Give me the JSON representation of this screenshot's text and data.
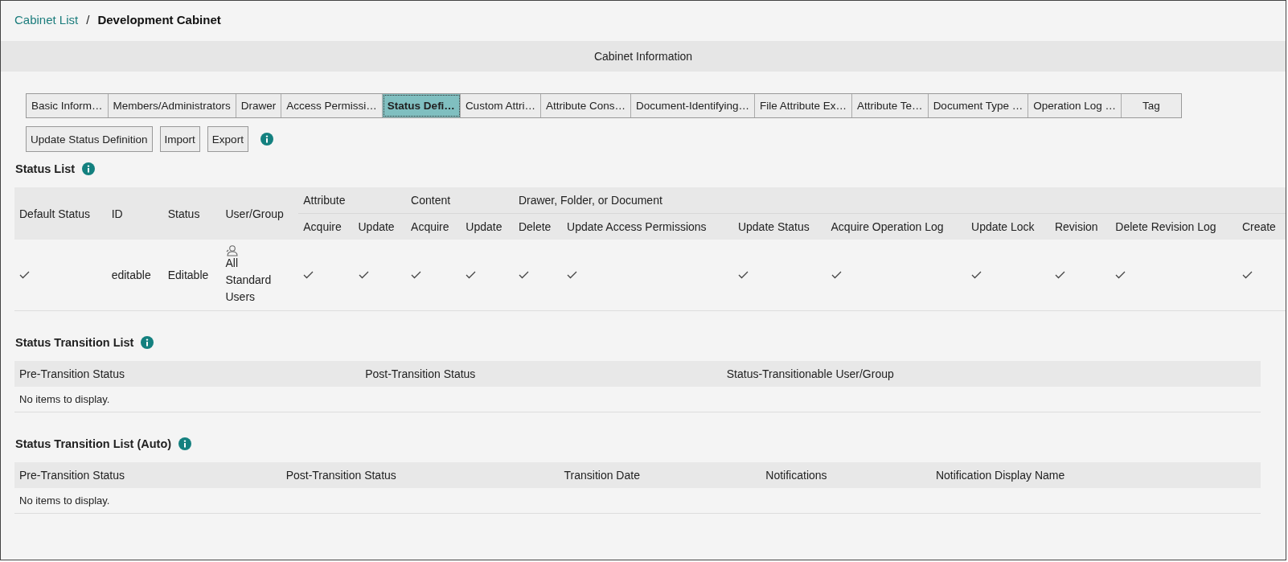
{
  "breadcrumb": {
    "link": "Cabinet List",
    "separator": "/",
    "current": "Development Cabinet"
  },
  "section_title": "Cabinet Information",
  "tabs": [
    {
      "label": "Basic Inform…",
      "selected": false
    },
    {
      "label": "Members/Administrators",
      "selected": false
    },
    {
      "label": "Drawer",
      "selected": false
    },
    {
      "label": "Access Permissi…",
      "selected": false
    },
    {
      "label": "Status Defi…",
      "selected": true
    },
    {
      "label": "Custom Attri…",
      "selected": false
    },
    {
      "label": "Attribute Cons…",
      "selected": false
    },
    {
      "label": "Document-Identifying…",
      "selected": false
    },
    {
      "label": "File Attribute Ex…",
      "selected": false
    },
    {
      "label": "Attribute Te…",
      "selected": false
    },
    {
      "label": "Document Type …",
      "selected": false
    },
    {
      "label": "Operation Log …",
      "selected": false
    },
    {
      "label": "Tag",
      "selected": false
    }
  ],
  "buttons": [
    "Update Status Definition",
    "Import",
    "Export"
  ],
  "status_list": {
    "title": "Status List",
    "columns": [
      "Default Status",
      "ID",
      "Status",
      "User/Group"
    ],
    "groups": [
      {
        "label": "Attribute",
        "columns": [
          "Acquire",
          "Update"
        ]
      },
      {
        "label": "Content",
        "columns": [
          "Acquire",
          "Update"
        ]
      },
      {
        "label": "Drawer, Folder, or Document",
        "columns": [
          "Delete",
          "Update Access Permissions",
          "Update Status",
          "Acquire Operation Log",
          "Update Lock",
          "Revision",
          "Delete Revision Log",
          "Create"
        ]
      }
    ],
    "rows": [
      {
        "default": true,
        "id": "editable",
        "status": "Editable",
        "user_group": "All Standard Users",
        "permissions": [
          true,
          true,
          true,
          true,
          true,
          true,
          true,
          true,
          true,
          true,
          true,
          true
        ]
      }
    ]
  },
  "transition_list": {
    "title": "Status Transition List",
    "columns": [
      "Pre-Transition Status",
      "Post-Transition Status",
      "Status-Transitionable User/Group"
    ],
    "empty": "No items to display."
  },
  "transition_list_auto": {
    "title": "Status Transition List (Auto)",
    "columns": [
      "Pre-Transition Status",
      "Post-Transition Status",
      "Transition Date",
      "Notifications",
      "Notification Display Name"
    ],
    "empty": "No items to display."
  }
}
